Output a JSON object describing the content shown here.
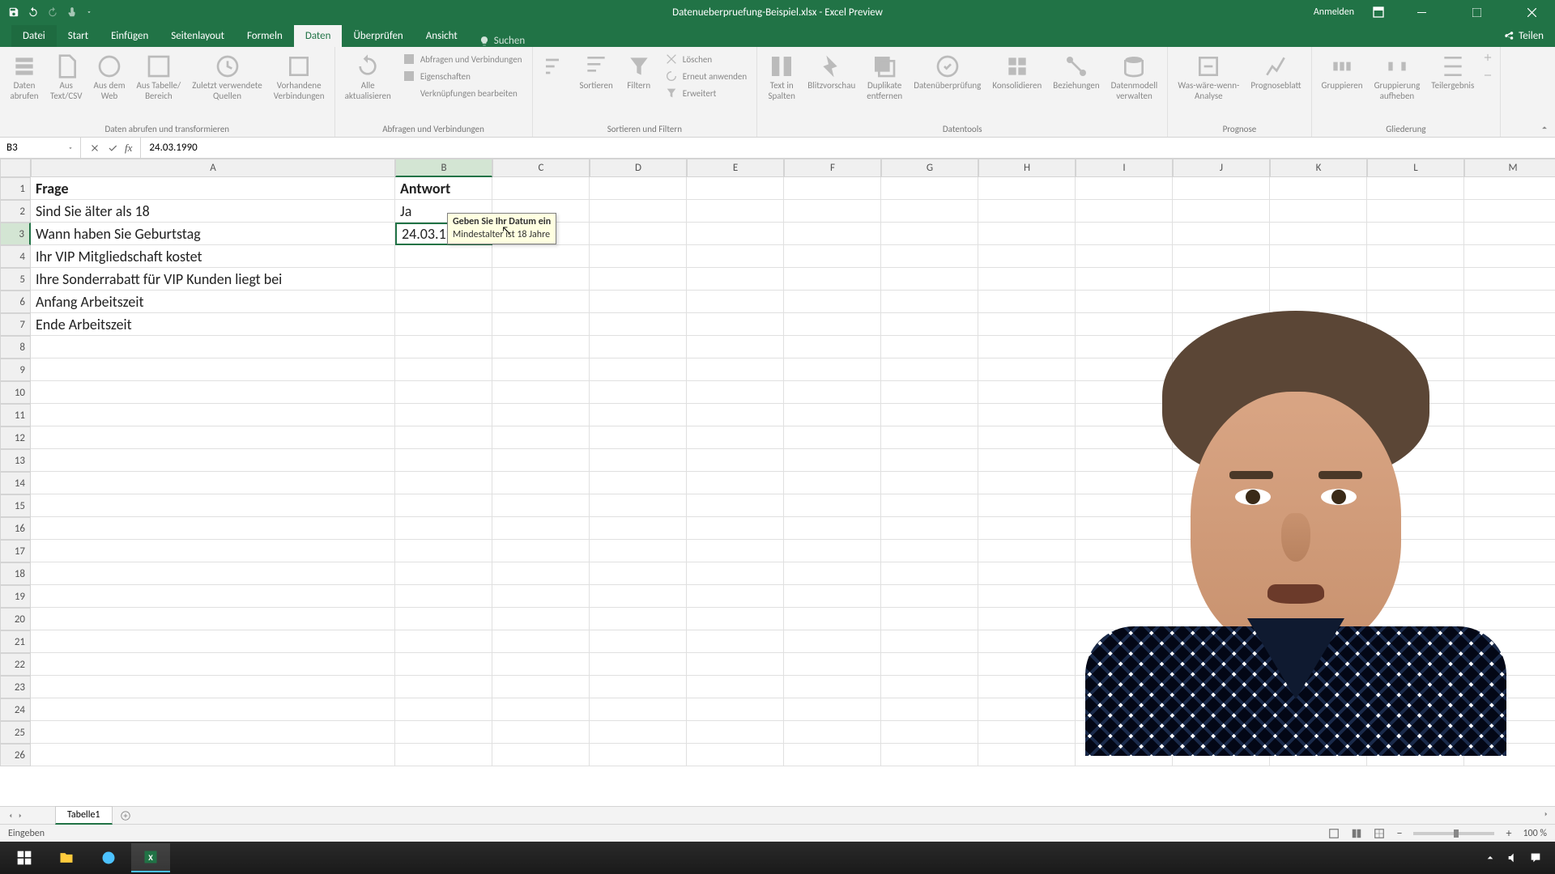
{
  "titlebar": {
    "title": "Datenueberpruefung-Beispiel.xlsx - Excel Preview",
    "signin": "Anmelden"
  },
  "tabs": {
    "file": "Datei",
    "start": "Start",
    "einfugen": "Einfügen",
    "seitenlayout": "Seitenlayout",
    "formeln": "Formeln",
    "daten": "Daten",
    "uberprufen": "Überprüfen",
    "ansicht": "Ansicht",
    "search": "Suchen",
    "share": "Teilen"
  },
  "ribbon": {
    "group_abrufen": "Daten abrufen und transformieren",
    "btn_abrufen": "Daten\nabrufen",
    "btn_textcsv": "Aus\nText/CSV",
    "btn_web": "Aus dem\nWeb",
    "btn_tabelle": "Aus Tabelle/\nBereich",
    "btn_zuletzt": "Zuletzt verwendete\nQuellen",
    "btn_vorhandene": "Vorhandene\nVerbindungen",
    "group_verbindungen": "Abfragen und Verbindungen",
    "btn_alle": "Alle\naktualisieren",
    "small_abfragen": "Abfragen und Verbindungen",
    "small_eigenschaften": "Eigenschaften",
    "small_verknupfungen": "Verknüpfungen bearbeiten",
    "group_sortieren": "Sortieren und Filtern",
    "btn_sortieren": "Sortieren",
    "btn_filtern": "Filtern",
    "small_loschen": "Löschen",
    "small_erneut": "Erneut anwenden",
    "small_erweitert": "Erweitert",
    "group_datentools": "Datentools",
    "btn_text_spalten": "Text in\nSpalten",
    "btn_blitz": "Blitzvorschau",
    "btn_dup": "Duplikate\nentfernen",
    "btn_daten": "Datenüberprüfung",
    "btn_konsol": "Konsolidieren",
    "btn_bezieh": "Beziehungen",
    "btn_modell": "Datenmodell\nverwalten",
    "group_prognose": "Prognose",
    "btn_was": "Was-wäre-wenn-\nAnalyse",
    "btn_prog": "Prognoseblatt",
    "group_gliederung": "Gliederung",
    "btn_grupp": "Gruppieren",
    "btn_grupp_auf": "Gruppierung\naufheben",
    "btn_teil": "Teilergebnis"
  },
  "formula": {
    "namebox": "B3",
    "content": "24.03.1990"
  },
  "columns": [
    "A",
    "B",
    "C",
    "D",
    "E",
    "F",
    "G",
    "H",
    "I",
    "J",
    "K",
    "L",
    "M"
  ],
  "rows": [
    {
      "n": "1",
      "A": "Frage",
      "B": "Antwort",
      "bold": true
    },
    {
      "n": "2",
      "A": "Sind Sie älter als 18",
      "B": "Ja"
    },
    {
      "n": "3",
      "A": "Wann haben Sie Geburtstag",
      "B": "24.03.1990",
      "editing": true
    },
    {
      "n": "4",
      "A": "Ihr VIP Mitgliedschaft kostet",
      "B": ""
    },
    {
      "n": "5",
      "A": "Ihre Sonderrabatt für VIP Kunden liegt bei",
      "B": ""
    },
    {
      "n": "6",
      "A": "Anfang Arbeitszeit",
      "B": ""
    },
    {
      "n": "7",
      "A": "Ende Arbeitszeit",
      "B": ""
    },
    {
      "n": "8"
    },
    {
      "n": "9"
    },
    {
      "n": "10"
    },
    {
      "n": "11"
    },
    {
      "n": "12"
    },
    {
      "n": "13"
    },
    {
      "n": "14"
    },
    {
      "n": "15"
    },
    {
      "n": "16"
    },
    {
      "n": "17"
    },
    {
      "n": "18"
    },
    {
      "n": "19"
    },
    {
      "n": "20"
    },
    {
      "n": "21"
    },
    {
      "n": "22"
    },
    {
      "n": "23"
    },
    {
      "n": "24"
    },
    {
      "n": "25"
    },
    {
      "n": "26"
    }
  ],
  "tooltip": {
    "line1": "Geben Sie Ihr Datum ein",
    "line2": "Mindestalter ist 18 Jahre"
  },
  "sheets": {
    "tab1": "Tabelle1"
  },
  "status": {
    "mode": "Eingeben",
    "zoom": "100 %"
  },
  "taskbar": {
    "time": ""
  }
}
